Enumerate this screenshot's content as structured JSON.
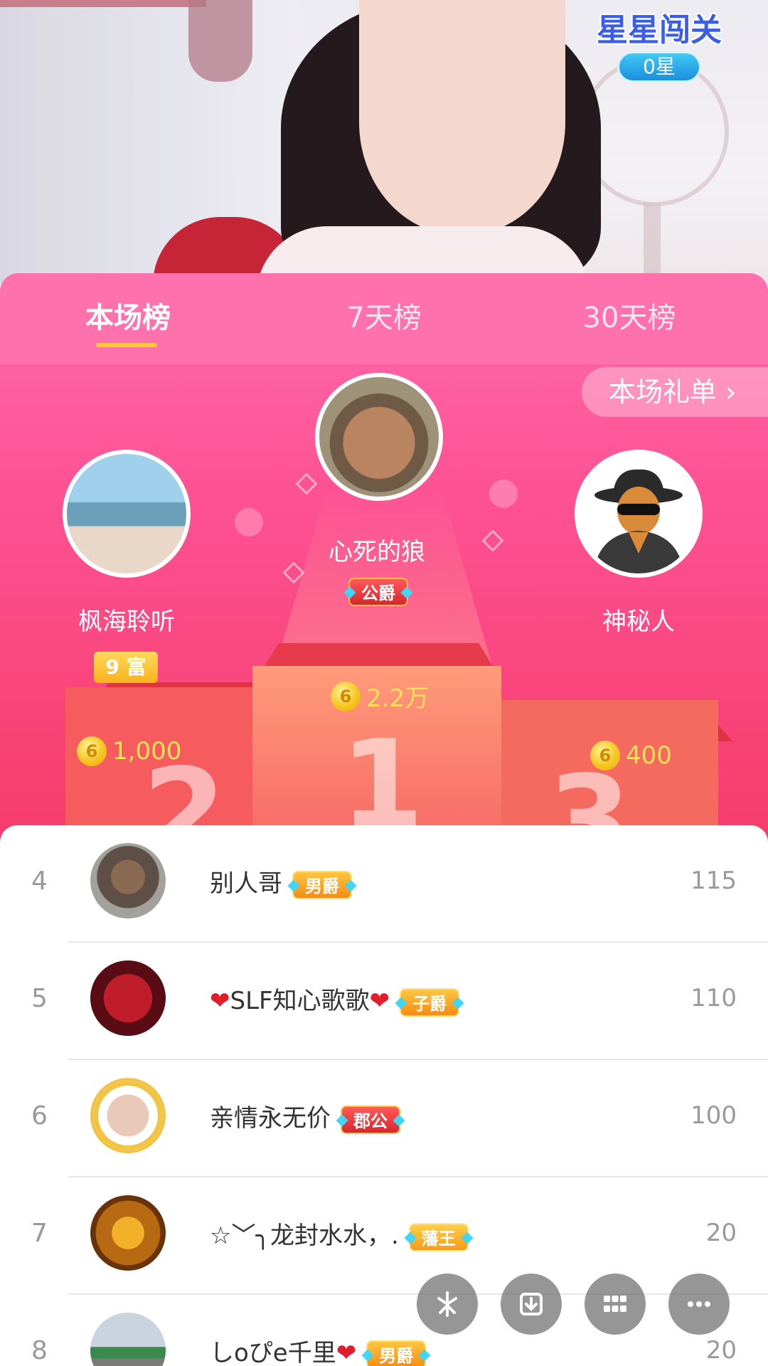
{
  "stream": {
    "stars_badge_title": "星星闯关",
    "stars_count": "0星"
  },
  "tabs": [
    {
      "label": "本场榜",
      "active": true
    },
    {
      "label": "7天榜",
      "active": false
    },
    {
      "label": "30天榜",
      "active": false
    }
  ],
  "gift_list_label": "本场礼单 ›",
  "podium": {
    "first": {
      "name": "心死的狼",
      "badge": "公爵",
      "score": "2.2万",
      "number": "1"
    },
    "second": {
      "name": "枫海聆听",
      "badge": "9 富",
      "score": "1,000",
      "number": "2"
    },
    "third": {
      "name": "神秘人",
      "score": "400",
      "number": "3"
    }
  },
  "coin_label": "6",
  "list": [
    {
      "rank": "4",
      "name": "别人哥",
      "badge": "男爵",
      "score": "115"
    },
    {
      "rank": "5",
      "name_prefix": "❤",
      "name": "SLF知心歌歌",
      "name_suffix": "❤",
      "badge": "子爵",
      "score": "110"
    },
    {
      "rank": "6",
      "name": "亲情永无价",
      "badge": "郡公",
      "score": "100"
    },
    {
      "rank": "7",
      "name": "☆﹀╮龙封水水，.",
      "badge": "藩王",
      "score": "20"
    },
    {
      "rank": "8",
      "name": "しoぴe千里",
      "name_suffix": "❤",
      "badge": "男爵",
      "score": "20"
    }
  ],
  "colors": {
    "tab_bg": "#ff71ad",
    "podium_pink": "#f4345c",
    "coin_gold": "#f6c621",
    "score_yellow": "#ffe15a",
    "rank_gray": "#9a9a9a"
  },
  "fab_icons": [
    "sparkle-icon",
    "download-icon",
    "grid-icon",
    "more-icon"
  ]
}
